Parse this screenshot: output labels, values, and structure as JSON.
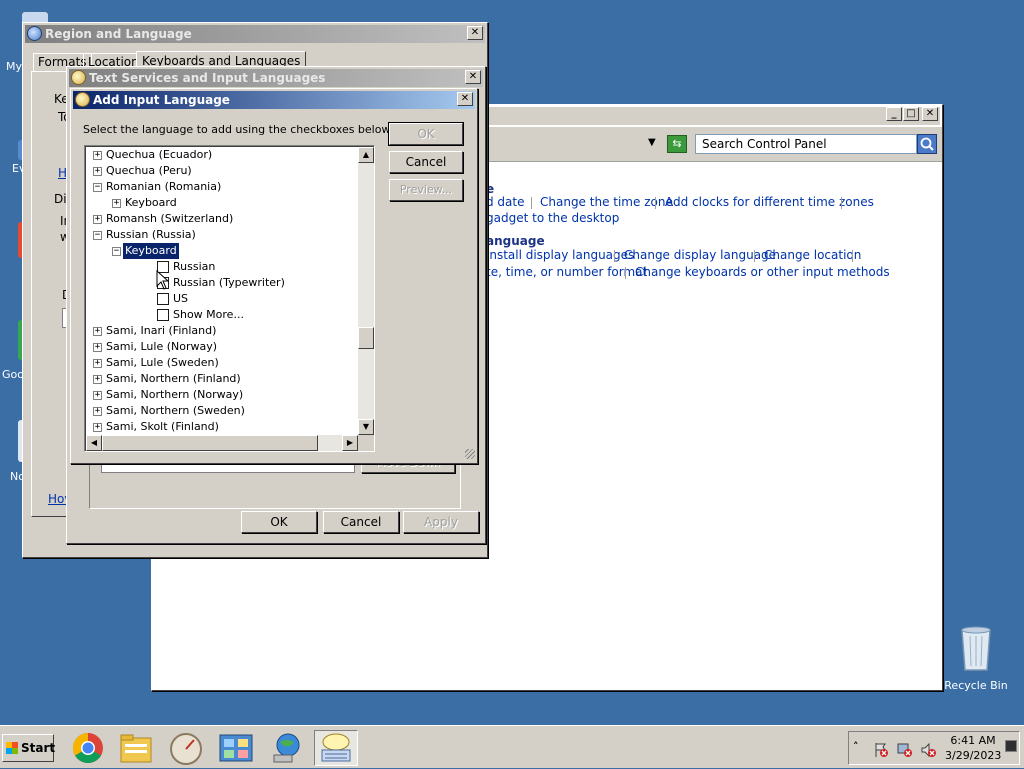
{
  "desktop": {
    "icons": [
      {
        "label": "My"
      },
      {
        "label": "Ev"
      },
      {
        "label": "Goo"
      },
      {
        "label": "No"
      }
    ],
    "recycle_bin_label": "Recycle Bin"
  },
  "control_panel": {
    "search_placeholder": "Search Control Panel",
    "section1_heading": "e",
    "section1_links": [
      "d date",
      "Change the time zone",
      "Add clocks for different time zones"
    ],
    "section1_line2": "gadget to the desktop",
    "section2_heading": "anguage",
    "section2_links": [
      "install display languages",
      "Change display language",
      "Change location"
    ],
    "section2_line2_links": [
      "te, time, or number format",
      "Change keyboards or other input methods"
    ]
  },
  "region_window": {
    "title": "Region and Language",
    "tabs": [
      "Formats",
      "Location",
      "Keyboards and Languages"
    ],
    "partial_labels": [
      "Ke",
      "To",
      "H",
      "Dis",
      "In",
      "w",
      "D",
      "Hov"
    ]
  },
  "text_services_window": {
    "title": "Text Services and Input Languages",
    "move_down_label": "Move Down",
    "buttons": {
      "ok": "OK",
      "cancel": "Cancel",
      "apply": "Apply"
    }
  },
  "add_input_language": {
    "title": "Add Input Language",
    "instruction": "Select the language to add using the checkboxes below.",
    "buttons": {
      "ok": "OK",
      "cancel": "Cancel",
      "preview": "Preview..."
    },
    "tree": [
      {
        "label": "Quechua (Ecuador)",
        "level": 0,
        "state": "collapsed"
      },
      {
        "label": "Quechua (Peru)",
        "level": 0,
        "state": "collapsed"
      },
      {
        "label": "Romanian (Romania)",
        "level": 0,
        "state": "expanded"
      },
      {
        "label": "Keyboard",
        "level": 1,
        "state": "collapsed"
      },
      {
        "label": "Romansh (Switzerland)",
        "level": 0,
        "state": "collapsed"
      },
      {
        "label": "Russian (Russia)",
        "level": 0,
        "state": "expanded"
      },
      {
        "label": "Keyboard",
        "level": 1,
        "state": "expanded",
        "selected": true
      },
      {
        "label": "Russian",
        "level": 2,
        "checkbox": true
      },
      {
        "label": "Russian (Typewriter)",
        "level": 2,
        "checkbox": true
      },
      {
        "label": "US",
        "level": 2,
        "checkbox": true
      },
      {
        "label": "Show More...",
        "level": 2,
        "checkbox": true
      },
      {
        "label": "Sami, Inari (Finland)",
        "level": 0,
        "state": "collapsed"
      },
      {
        "label": "Sami, Lule (Norway)",
        "level": 0,
        "state": "collapsed"
      },
      {
        "label": "Sami, Lule (Sweden)",
        "level": 0,
        "state": "collapsed"
      },
      {
        "label": "Sami, Northern (Finland)",
        "level": 0,
        "state": "collapsed"
      },
      {
        "label": "Sami, Northern (Norway)",
        "level": 0,
        "state": "collapsed"
      },
      {
        "label": "Sami, Northern (Sweden)",
        "level": 0,
        "state": "collapsed"
      },
      {
        "label": "Sami, Skolt (Finland)",
        "level": 0,
        "state": "collapsed"
      }
    ]
  },
  "taskbar": {
    "start_label": "Start",
    "apps": [
      "chrome-icon",
      "folder-icon",
      "gauge-icon",
      "control-panel-icon",
      "globe-icon",
      "keyboard-icon"
    ],
    "clock_time": "6:41 AM",
    "clock_date": "3/29/2023"
  },
  "colors": {
    "desktop": "#3a6ea5",
    "selection": "#0a246a",
    "link": "#0033aa"
  }
}
